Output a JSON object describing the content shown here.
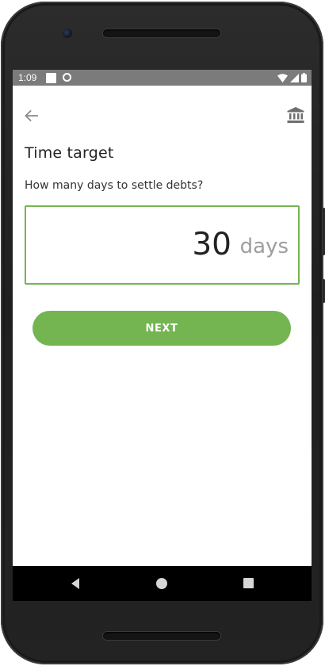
{
  "status_bar": {
    "time": "1:09"
  },
  "app_bar": {
    "back_icon": "arrow-back-icon",
    "bank_icon": "bank-icon"
  },
  "page": {
    "title": "Time target",
    "question": "How many days to settle debts?"
  },
  "days_input": {
    "value": "30",
    "unit": "days"
  },
  "next_button": {
    "label": "NEXT"
  },
  "colors": {
    "accent": "#74b552",
    "status_bar": "#7b7b7b",
    "nav_bar": "#000000"
  }
}
